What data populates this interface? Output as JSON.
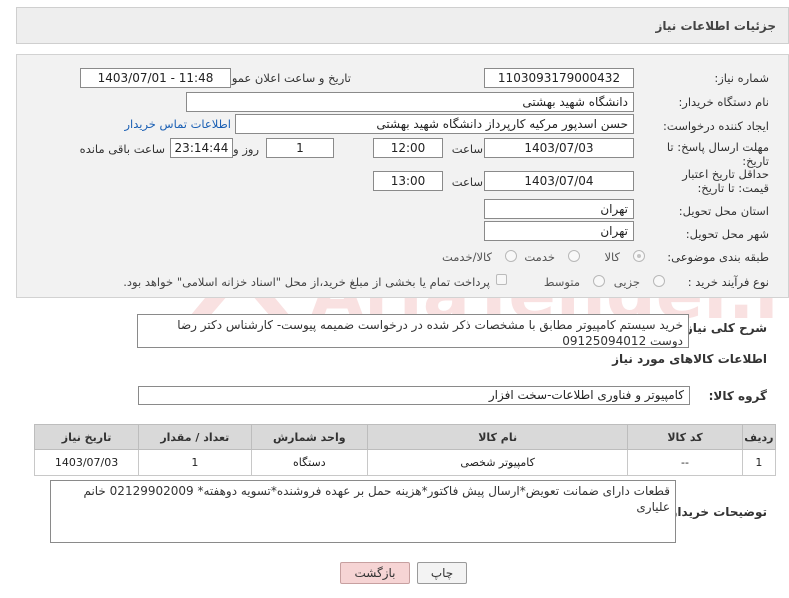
{
  "header": {
    "title": "جزئیات اطلاعات نیاز"
  },
  "form": {
    "need_number_label": "شماره نیاز:",
    "need_number": "1103093179000432",
    "announce_label": "تاریخ و ساعت اعلان عمومی:",
    "announce_value": "1403/07/01 - 11:48",
    "buyer_org_label": "نام دستگاه خریدار:",
    "buyer_org": "دانشگاه شهید بهشتی",
    "creator_label": "ایجاد کننده درخواست:",
    "creator": "حسن اسدپور مرکیه کارپرداز دانشگاه شهید بهشتی",
    "contact_link": "اطلاعات تماس خریدار",
    "deadline_label": "مهلت ارسال پاسخ: تا تاریخ:",
    "deadline_date": "1403/07/03",
    "deadline_time_label": "ساعت",
    "deadline_time": "12:00",
    "days_value": "1",
    "days_label": "روز و",
    "remaining_time": "23:14:44",
    "remaining_label": "ساعت باقی مانده",
    "validity_label": "حداقل تاریخ اعتبار قیمت: تا تاریخ:",
    "validity_date": "1403/07/04",
    "validity_time_label": "ساعت",
    "validity_time": "13:00",
    "province_label": "استان محل تحویل:",
    "province": "تهران",
    "city_label": "شهر محل تحویل:",
    "city": "تهران",
    "category_label": "طبقه بندی موضوعی:",
    "category_options": [
      "کالا",
      "خدمت",
      "کالا/خدمت"
    ],
    "process_label": "نوع فرآیند خرید :",
    "process_options": [
      "جزیی",
      "متوسط"
    ],
    "payment_note": "پرداخت تمام یا بخشی از مبلغ خرید،از محل \"اسناد خزانه اسلامی\" خواهد بود."
  },
  "summary": {
    "label": "شرح کلی نیاز:",
    "text": "خرید سیستم کامپیوتر مطابق با مشخصات ذکر شده در درخواست ضمیمه پیوست- کارشناس دکتر رضا دوست 09125094012"
  },
  "goods": {
    "section_title": "اطلاعات کالاهای مورد نیاز",
    "group_label": "گروه کالا:",
    "group_value": "کامپیوتر و فناوری اطلاعات-سخت افزار",
    "columns": [
      "ردیف",
      "کد کالا",
      "نام کالا",
      "واحد شمارش",
      "تعداد / مقدار",
      "تاریخ نیاز"
    ],
    "rows": [
      {
        "row": "1",
        "code": "--",
        "name": "کامپیوتر شخصی",
        "unit": "دستگاه",
        "qty": "1",
        "date": "1403/07/03"
      }
    ]
  },
  "buyer_notes": {
    "label": "توضیحات خریدار:",
    "text": "قطعات دارای ضمانت تعویض*ارسال پیش فاکتور*هزینه حمل بر عهده فروشنده*تسویه دوهفته* 02129902009 خانم علیاری"
  },
  "buttons": {
    "print": "چاپ",
    "back": "بازگشت"
  },
  "watermark": {
    "text": "AriaTender.neT"
  },
  "colors": {
    "link": "#1a5fb4",
    "back_button": "#f6d4d4",
    "table_header": "#d9d9d9"
  }
}
